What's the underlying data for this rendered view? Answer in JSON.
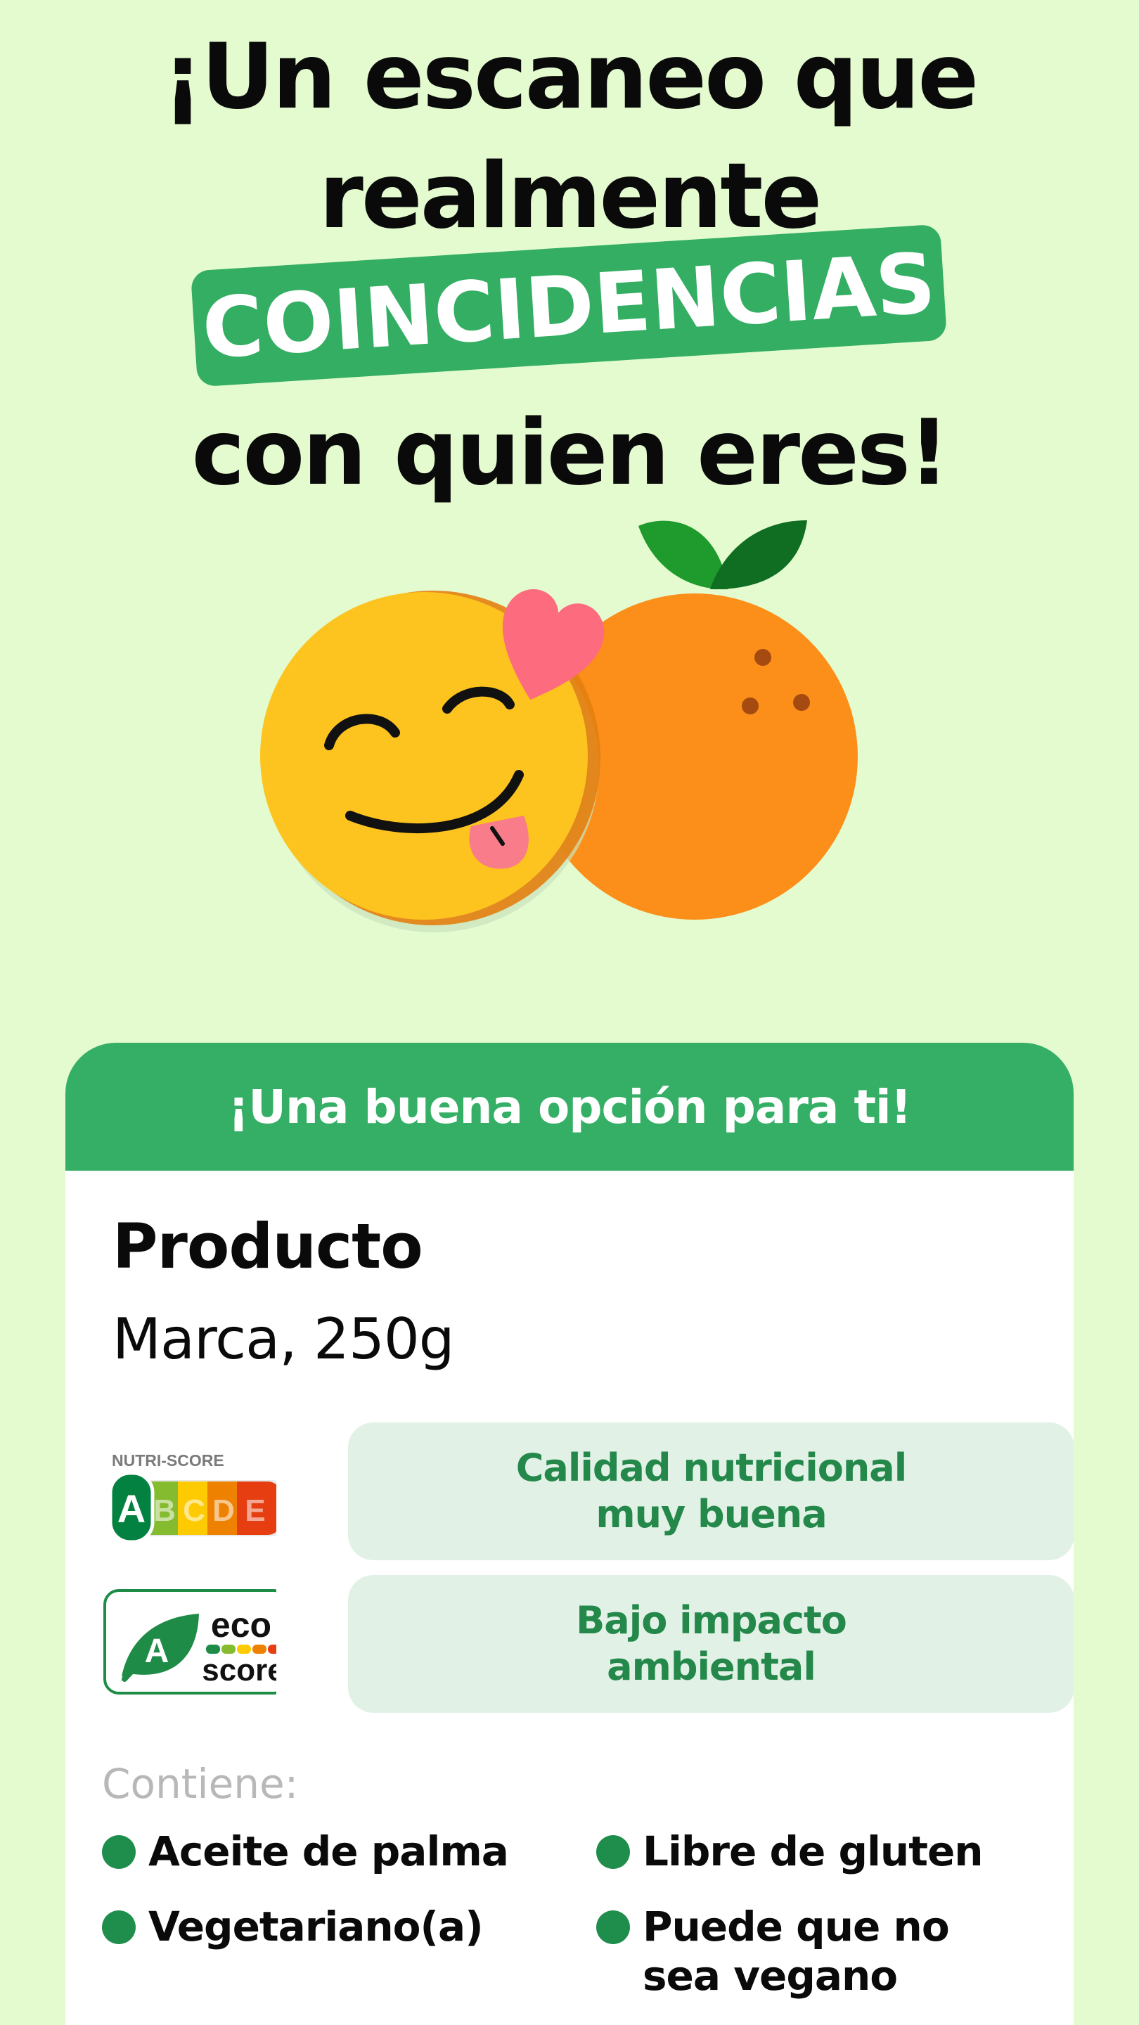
{
  "headline": {
    "line1": "¡Un escaneo que",
    "line2": "realmente",
    "highlight": "COINCIDENCIAS",
    "line3": "con quien eres!"
  },
  "card": {
    "header": "¡Una buena opción para ti!",
    "product_name": "Producto",
    "product_brand": "Marca, 250g",
    "nutri_score": {
      "caption": "NUTRI-SCORE",
      "grades": [
        "A",
        "B",
        "C",
        "D",
        "E"
      ],
      "selected": "A",
      "description": "Calidad nutricional muy buena"
    },
    "eco_score": {
      "grade": "A",
      "word_top": "eco",
      "word_bottom": "score",
      "description": "Bajo impacto ambiental"
    },
    "contains_label": "Contiene:",
    "attributes": [
      "Aceite de palma",
      "Libre de gluten",
      "Vegetariano(a)",
      "Puede que no sea vegano"
    ]
  },
  "colors": {
    "background": "#e4fbd0",
    "brand_green": "#35af66",
    "pill_bg": "#e2f1e6",
    "pill_text": "#23884a",
    "dot": "#1f8e4d",
    "emoji_yellow": "#fdc31f",
    "orange": "#fb8f1a",
    "heart": "#fd6b7f"
  },
  "icons": [
    "smiling-face-emoji-icon",
    "orange-fruit-icon",
    "heart-icon",
    "leaf-icon",
    "nutri-score-badge-icon",
    "eco-score-badge-icon"
  ]
}
